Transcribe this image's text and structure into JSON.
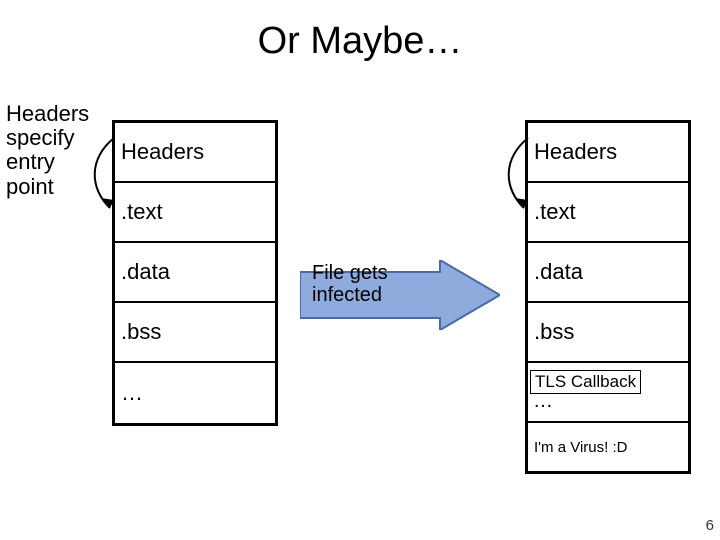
{
  "title": "Or Maybe…",
  "side_note_lines": {
    "l1": "Headers",
    "l2": "specify",
    "l3": "entry",
    "l4": "point"
  },
  "left_stack": {
    "r0": "Headers",
    "r1": ".text",
    "r2": ".data",
    "r3": ".bss",
    "r4": "…"
  },
  "right_stack": {
    "r0": "Headers",
    "r1": ".text",
    "r2": ".data",
    "r3": ".bss",
    "r4_under": "…",
    "r5": "I'm a Virus! :D"
  },
  "tls_label": "TLS Callback",
  "mid_arrow_label": {
    "l1": "File gets",
    "l2": "infected"
  },
  "page_number": "6",
  "colors": {
    "arrow_fill": "#8faadc",
    "arrow_stroke": "#4a6aa5"
  },
  "chart_data": {
    "type": "table",
    "title": "Or Maybe…",
    "note": "Executable file layout before and after infection; headers specify entry point; after infection a TLS Callback section and a virus section are appended.",
    "before_sections": [
      "Headers",
      ".text",
      ".data",
      ".bss",
      "…"
    ],
    "after_sections": [
      "Headers",
      ".text",
      ".data",
      ".bss",
      "… (TLS Callback)",
      "I'm a Virus! :D"
    ],
    "transition_label": "File gets infected",
    "entry_point_arrow": {
      "from": "Headers",
      "to": ".text"
    },
    "overlay_on_ellipsis_after": "TLS Callback"
  }
}
